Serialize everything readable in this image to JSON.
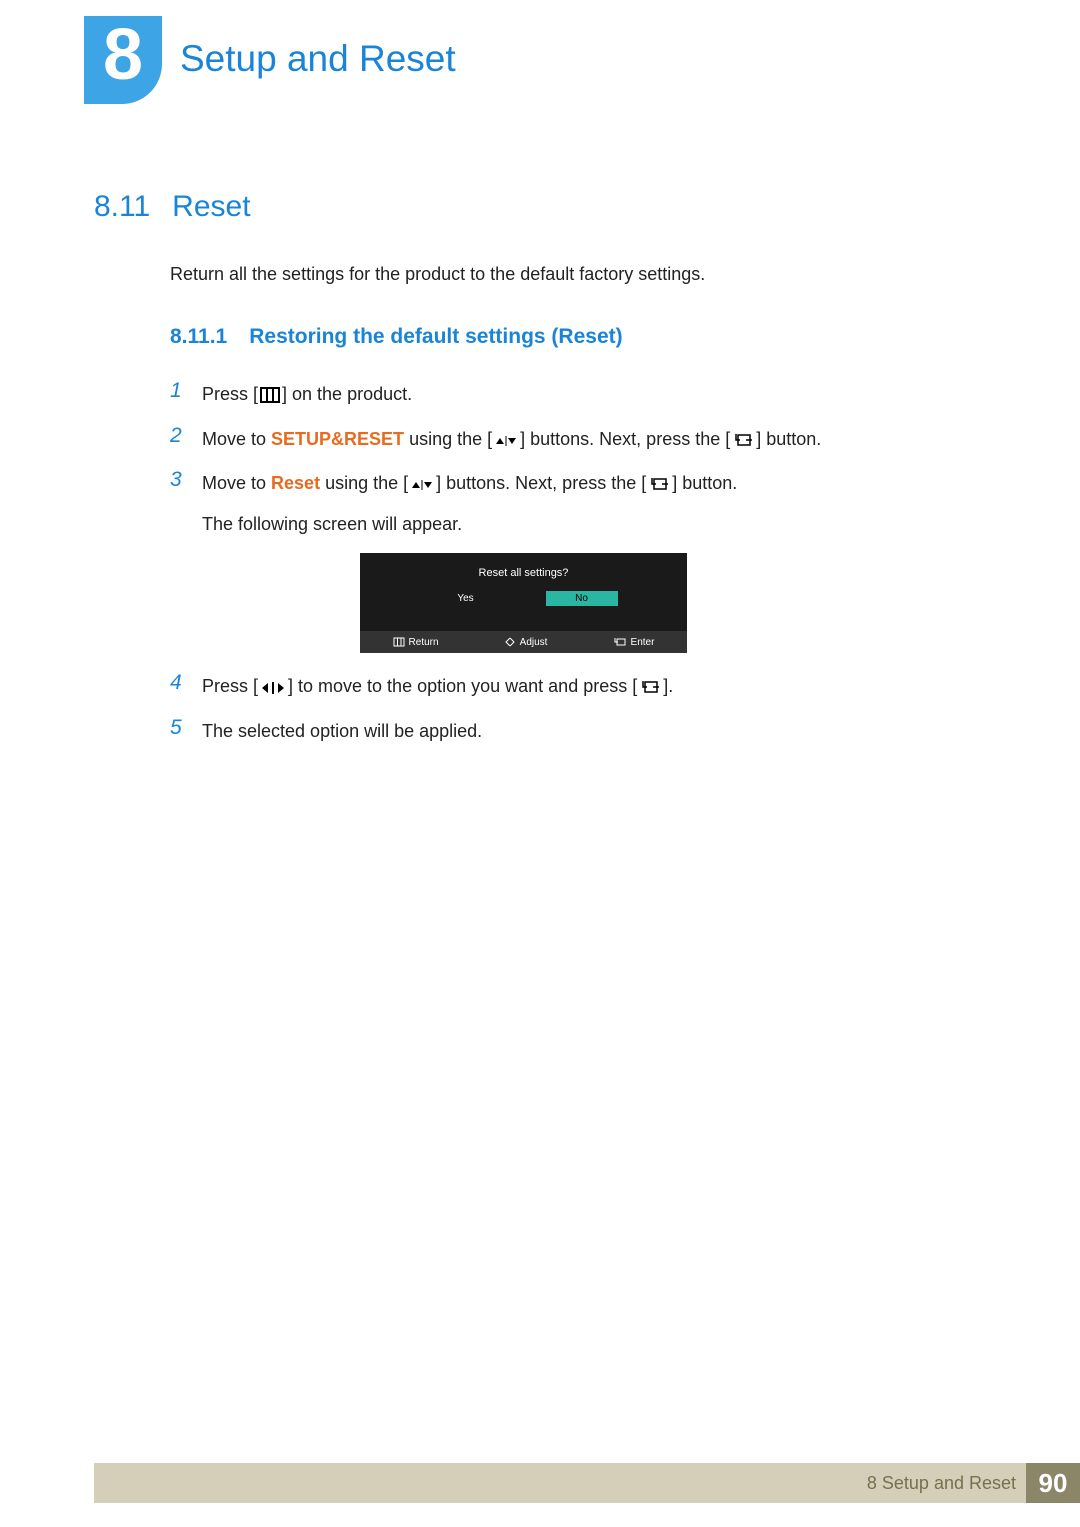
{
  "chapter": {
    "number": "8",
    "title": "Setup and Reset"
  },
  "section": {
    "number": "8.11",
    "title": "Reset",
    "description": "Return all the settings for the product to the default factory settings."
  },
  "subsection": {
    "number": "8.11.1",
    "title": "Restoring the default settings (Reset)"
  },
  "steps": {
    "s1": {
      "num": "1",
      "t1": "Press [",
      "t2": "] on the product."
    },
    "s2": {
      "num": "2",
      "t1": "Move to ",
      "bold": "SETUP&RESET",
      "t2": " using the [",
      "t3": "] buttons. Next, press the [",
      "t4": "] button."
    },
    "s3": {
      "num": "3",
      "t1": "Move to ",
      "bold": "Reset",
      "t2": " using the [",
      "t3": "] buttons. Next, press the [",
      "t4": "] button.",
      "after": "The following screen will appear."
    },
    "s4": {
      "num": "4",
      "t1": "Press [",
      "t2": "] to move to the option you want and press [",
      "t3": "]."
    },
    "s5": {
      "num": "5",
      "t1": "The selected option will be applied."
    }
  },
  "osd": {
    "title": "Reset all settings?",
    "yes": "Yes",
    "no": "No",
    "return": "Return",
    "adjust": "Adjust",
    "enter": "Enter"
  },
  "footer": {
    "title": "8 Setup and Reset",
    "page": "90"
  }
}
